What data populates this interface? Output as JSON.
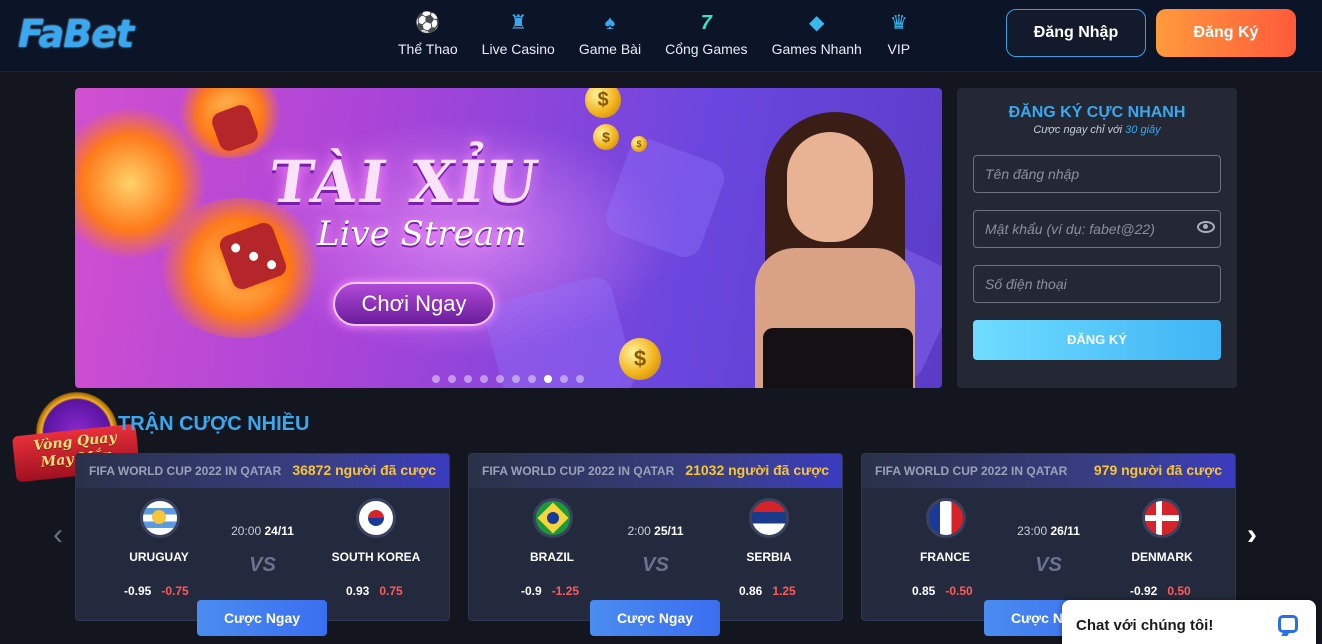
{
  "brand": {
    "logo_text": "FaBet"
  },
  "nav": [
    {
      "label": "Thể Thao",
      "icon": "sports-ball-icon",
      "glyph": "⚽",
      "color": "#ff5a3a"
    },
    {
      "label": "Live Casino",
      "icon": "casino-chip-icon",
      "glyph": "♜",
      "color": "#3aa8ee"
    },
    {
      "label": "Game Bài",
      "icon": "spade-card-icon",
      "glyph": "♠",
      "color": "#3aa8ee"
    },
    {
      "label": "Cổng Games",
      "icon": "lucky-seven-icon",
      "glyph": "7",
      "color": "#3ae0c8"
    },
    {
      "label": "Games Nhanh",
      "icon": "cube-icon",
      "glyph": "◆",
      "color": "#3ab8ee"
    },
    {
      "label": "VIP",
      "icon": "trophy-icon",
      "glyph": "♛",
      "color": "#3ab8ee"
    }
  ],
  "auth": {
    "login_label": "Đăng Nhập",
    "register_label": "Đăng Ký"
  },
  "banner": {
    "title": "TÀI XỈU",
    "subtitle": "Live Stream",
    "cta_label": "Chơi Ngay",
    "slide_count": 10,
    "active_slide": 8
  },
  "register_form": {
    "title": "ĐĂNG KÝ CỰC NHANH",
    "subtitle_prefix": "Cược ngay chỉ với",
    "subtitle_highlight": "30 giây",
    "username_placeholder": "Tên đăng nhập",
    "password_placeholder": "Mật khẩu (ví dụ: fabet@22)",
    "phone_placeholder": "Số điện thoại",
    "submit_label": "ĐĂNG KÝ"
  },
  "lucky_wheel": {
    "line1": "Vòng Quay",
    "line2": "May Mắn"
  },
  "section": {
    "title": "TRẬN CƯỢC NHIỀU"
  },
  "matches": [
    {
      "league": "FIFA WORLD CUP 2022 IN QATAR",
      "bets": "36872 người đã cược",
      "time": "20:00",
      "date": "24/11",
      "vs": "VS",
      "home": {
        "name": "URUGUAY",
        "flag": "uruguay",
        "odd1": "-0.95",
        "odd2": "-0.75"
      },
      "away": {
        "name": "SOUTH KOREA",
        "flag": "south-korea",
        "odd1": "0.93",
        "odd2": "0.75"
      },
      "bet_label": "Cược Ngay"
    },
    {
      "league": "FIFA WORLD CUP 2022 IN QATAR",
      "bets": "21032 người đã cược",
      "time": "2:00",
      "date": "25/11",
      "vs": "VS",
      "home": {
        "name": "BRAZIL",
        "flag": "brazil",
        "odd1": "-0.9",
        "odd2": "-1.25"
      },
      "away": {
        "name": "SERBIA",
        "flag": "serbia",
        "odd1": "0.86",
        "odd2": "1.25"
      },
      "bet_label": "Cược Ngay"
    },
    {
      "league": "FIFA WORLD CUP 2022 IN QATAR",
      "bets": "979 người đã cược",
      "time": "23:00",
      "date": "26/11",
      "vs": "VS",
      "home": {
        "name": "FRANCE",
        "flag": "france",
        "odd1": "0.85",
        "odd2": "-0.50"
      },
      "away": {
        "name": "DENMARK",
        "flag": "denmark",
        "odd1": "-0.92",
        "odd2": "0.50"
      },
      "bet_label": "Cược Ngay"
    }
  ],
  "carousel": {
    "prev_icon": "chevron-left-icon",
    "next_icon": "chevron-right-icon"
  },
  "chat": {
    "label": "Chat với chúng tôi!"
  },
  "colors": {
    "accent": "#3aa8ee",
    "cta_orange": "#ff7a3a",
    "bets_gold": "#f5c53a",
    "odds_red": "#ff5a5a"
  }
}
